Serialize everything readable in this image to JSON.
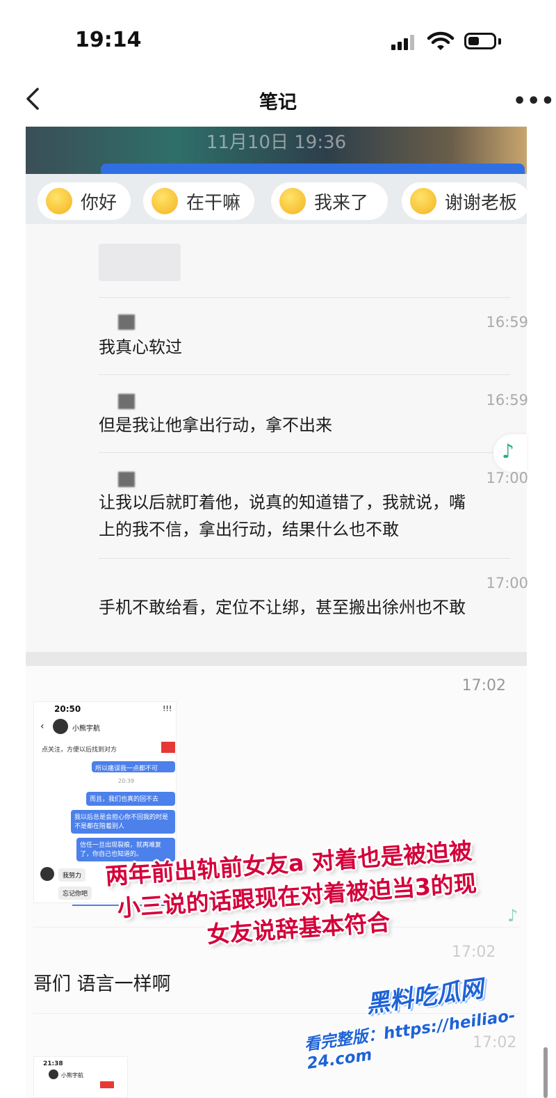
{
  "status_bar": {
    "time": "19:14",
    "battery_level": 0.45
  },
  "nav": {
    "title": "笔记"
  },
  "banner": {
    "timestamp": "11月10日 19:36"
  },
  "quick_replies": [
    {
      "label": "你好",
      "icon": "wink-emoji-icon"
    },
    {
      "label": "在干嘛",
      "icon": "curious-emoji-icon"
    },
    {
      "label": "我来了",
      "icon": "sunglasses-emoji-icon"
    },
    {
      "label": "谢谢老板",
      "icon": "thanks-emoji-icon"
    }
  ],
  "messages": [
    {
      "time": "16:59",
      "lines": [
        "我真心软过"
      ]
    },
    {
      "time": "16:59",
      "lines": [
        "但是我让他拿出行动，拿不出来"
      ]
    },
    {
      "time": "17:00",
      "lines": [
        "让我以后就盯着他，说真的知道错了，我就说，嘴",
        "上的我不信，拿出行动，结果什么也不敢"
      ]
    },
    {
      "time": "17:00",
      "lines": [
        "手机不敢给看，定位不让绑，甚至搬出徐州也不敢"
      ]
    }
  ],
  "lower": {
    "time": "17:02",
    "ghost_time": "17:02",
    "ghost_time2": "17:02",
    "text": "哥们 语言一样啊"
  },
  "embedded_phone": {
    "time": "20:50",
    "signal": "!!!",
    "name": "小熊宇航",
    "follow_tip": "点关注，方便以后找到对方",
    "bubbles": [
      "所以痛误我一点都不可",
      "20:39",
      "而且，我们也真的回不去",
      "我以后总是会担心你不回我的时是不是都在陪着别人",
      "信任一旦出现裂痕，就再难复了，你自己也知道的。"
    ],
    "replies": [
      "我努力",
      "忘记你吧"
    ]
  },
  "embedded_phone2": {
    "time": "21:38",
    "name": "小熊宇航"
  },
  "caption": {
    "lines": [
      "两年前出轨前女友a 对着也是被迫被",
      "小三说的话跟现在对着被迫当3的现",
      "女友说辞基本符合"
    ],
    "color": "#d4003a"
  },
  "watermark": {
    "logo": "黑料吃瓜网",
    "url": "看完整版：https://heiliao-24.com",
    "color": "#1e63d6"
  }
}
